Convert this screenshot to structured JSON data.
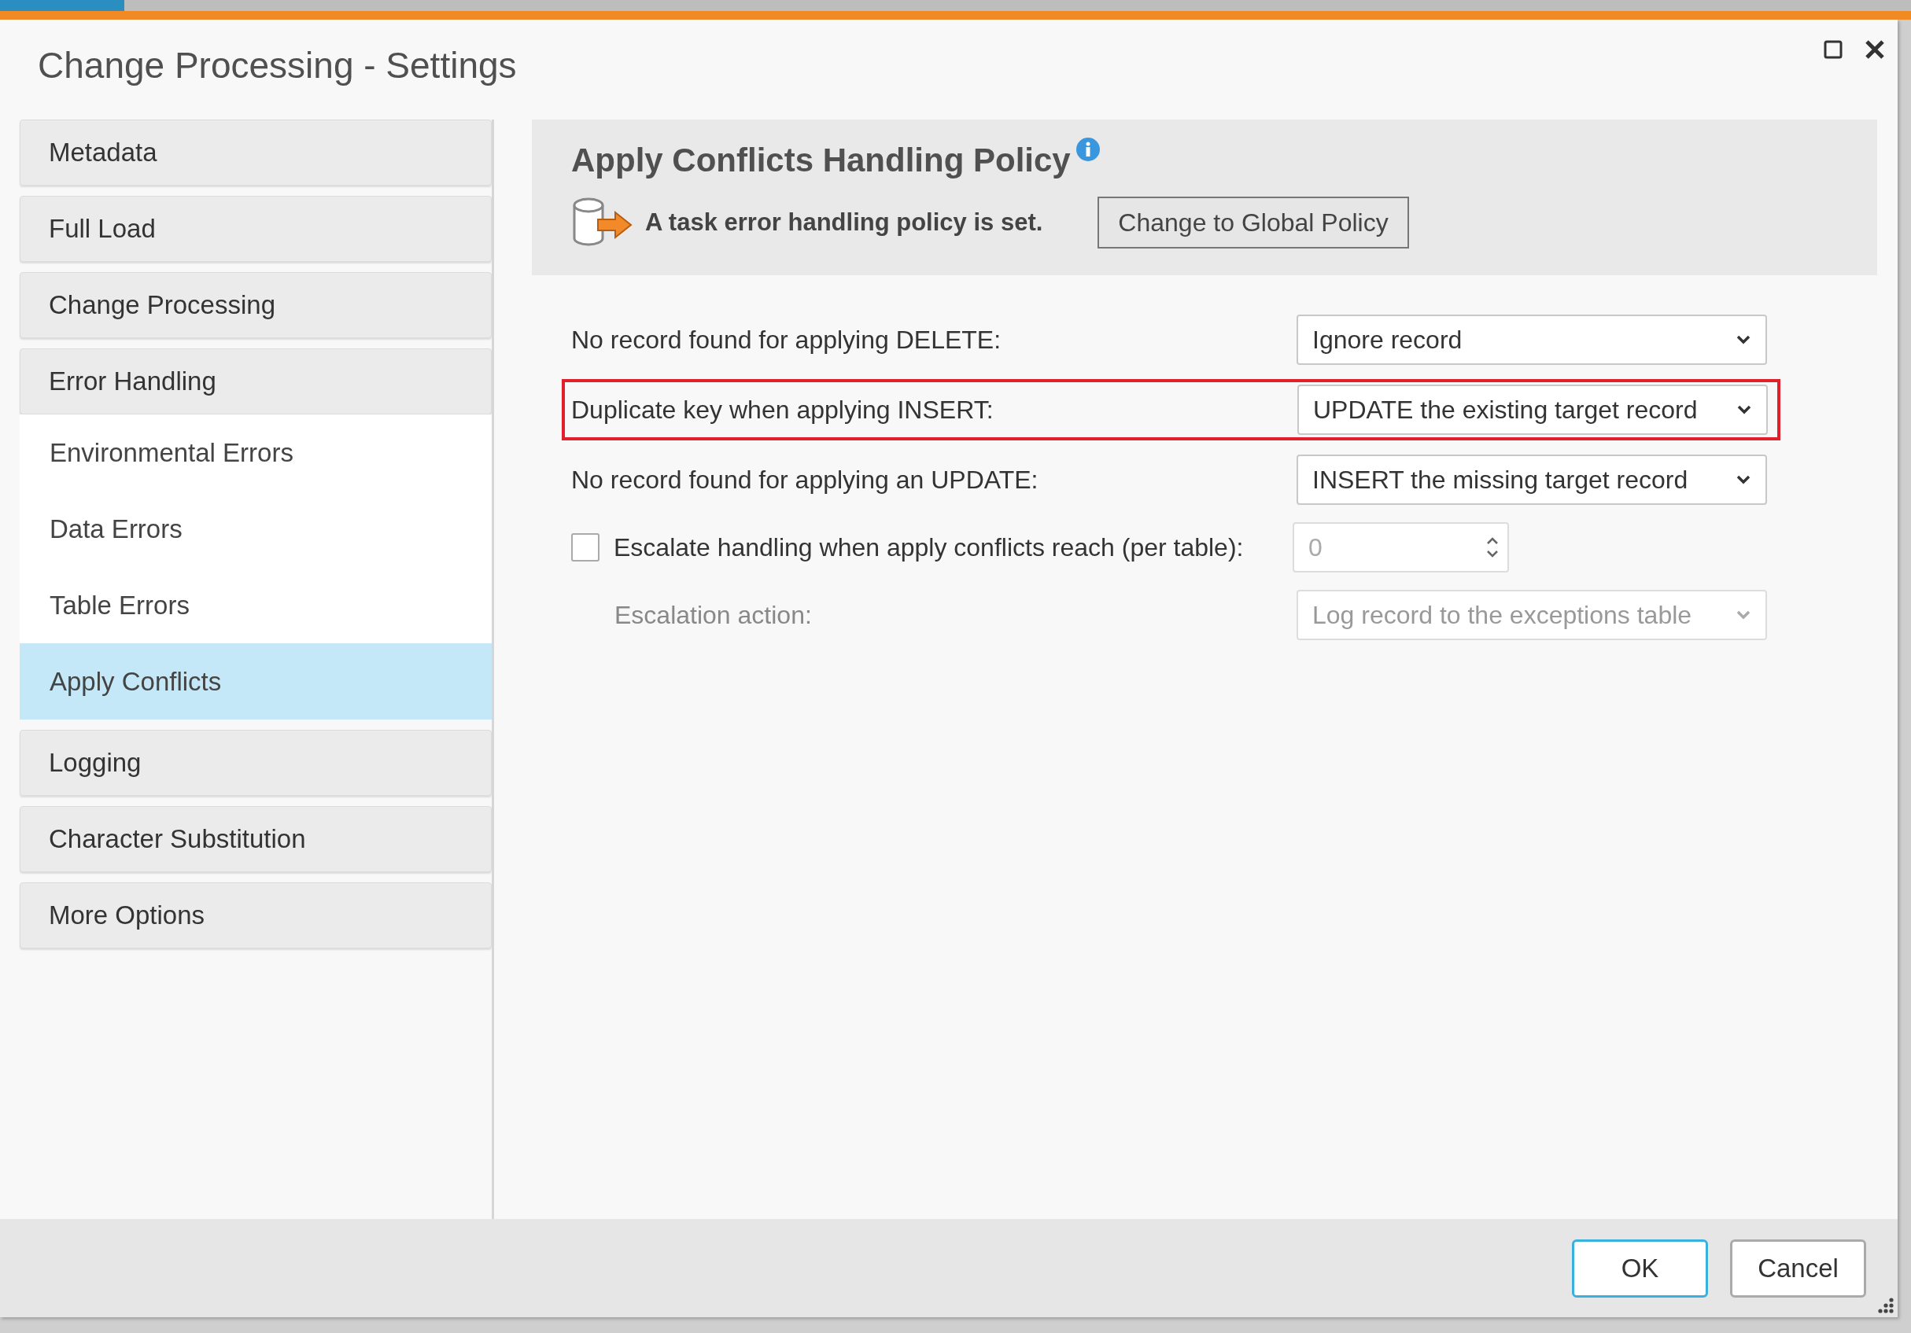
{
  "window": {
    "title": "Change Processing - Settings"
  },
  "sidebar": {
    "items": [
      {
        "label": "Metadata",
        "selected": false
      },
      {
        "label": "Full Load",
        "selected": false
      },
      {
        "label": "Change Processing",
        "selected": false
      },
      {
        "label": "Error Handling",
        "selected": false,
        "expanded": true,
        "children": [
          {
            "label": "Environmental Errors",
            "selected": false
          },
          {
            "label": "Data Errors",
            "selected": false
          },
          {
            "label": "Table Errors",
            "selected": false
          },
          {
            "label": "Apply Conflicts",
            "selected": true
          }
        ]
      },
      {
        "label": "Logging",
        "selected": false
      },
      {
        "label": "Character Substitution",
        "selected": false
      },
      {
        "label": "More Options",
        "selected": false
      }
    ]
  },
  "panel": {
    "title": "Apply Conflicts Handling Policy",
    "notice": "A task error handling policy is set.",
    "policy_button": "Change to Global Policy"
  },
  "fields": [
    {
      "kind": "select",
      "label": "No record found for applying DELETE:",
      "value": "Ignore record",
      "disabled": false,
      "highlighted": false
    },
    {
      "kind": "select",
      "label": "Duplicate key when applying INSERT:",
      "value": "UPDATE the existing target record",
      "disabled": false,
      "highlighted": true
    },
    {
      "kind": "select",
      "label": "No record found for applying an UPDATE:",
      "value": "INSERT the missing target record",
      "disabled": false,
      "highlighted": false
    },
    {
      "kind": "number",
      "label": "Escalate handling when apply conflicts reach (per table):",
      "checked": false,
      "value": "0",
      "disabled": true,
      "highlighted": false
    },
    {
      "kind": "select",
      "label": "Escalation action:",
      "value": "Log record to the exceptions table",
      "disabled": true,
      "highlighted": false,
      "indented": true
    }
  ],
  "buttons": [
    {
      "label": "OK",
      "default": true
    },
    {
      "label": "Cancel",
      "default": false
    }
  ]
}
